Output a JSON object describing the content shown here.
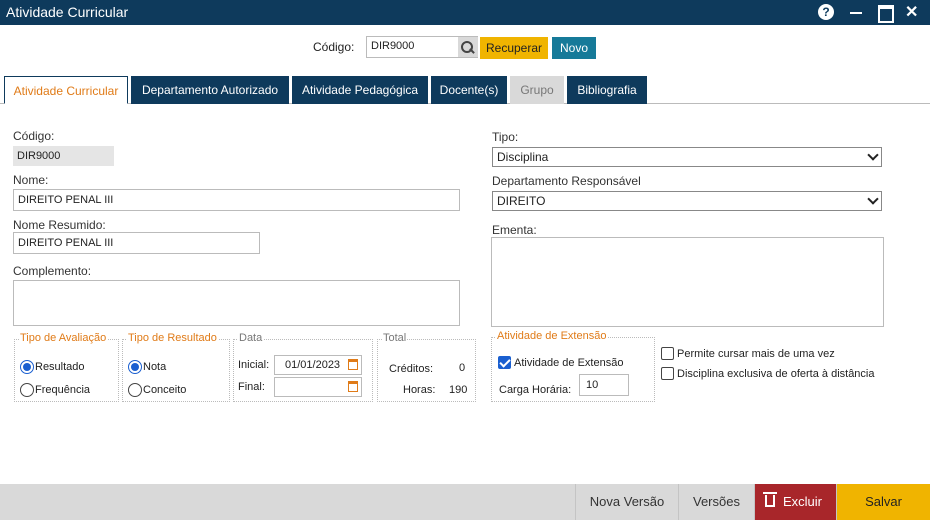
{
  "window": {
    "title": "Atividade Curricular"
  },
  "search": {
    "label": "Código:",
    "value": "DIR9000",
    "recuperar": "Recuperar",
    "novo": "Novo"
  },
  "tabs": [
    {
      "label": "Atividade Curricular",
      "state": "active"
    },
    {
      "label": "Departamento Autorizado",
      "state": "normal"
    },
    {
      "label": "Atividade Pedagógica",
      "state": "normal"
    },
    {
      "label": "Docente(s)",
      "state": "normal"
    },
    {
      "label": "Grupo",
      "state": "disabled"
    },
    {
      "label": "Bibliografia",
      "state": "normal"
    }
  ],
  "form": {
    "codigo_label": "Código:",
    "codigo_value": "DIR9000",
    "nome_label": "Nome:",
    "nome_value": "DIREITO PENAL III",
    "nome_resumido_label": "Nome Resumido:",
    "nome_resumido_value": "DIREITO PENAL III",
    "complemento_label": "Complemento:",
    "tipo_label": "Tipo:",
    "tipo_value": "Disciplina",
    "depto_label": "Departamento Responsável",
    "depto_value": "DIREITO",
    "ementa_label": "Ementa:"
  },
  "tipo_avaliacao": {
    "title": "Tipo de Avaliação",
    "options": [
      "Resultado",
      "Frequência"
    ],
    "selected": "Resultado"
  },
  "tipo_resultado": {
    "title": "Tipo de Resultado",
    "options": [
      "Nota",
      "Conceito"
    ],
    "selected": "Nota"
  },
  "data": {
    "title": "Data",
    "inicial_label": "Inicial:",
    "inicial_value": "01/01/2023",
    "final_label": "Final:",
    "final_value": ""
  },
  "total": {
    "title": "Total",
    "creditos_label": "Créditos:",
    "creditos_value": "0",
    "horas_label": "Horas:",
    "horas_value": "190"
  },
  "extensao": {
    "title": "Atividade de Extensão",
    "check_label": "Atividade de Extensão",
    "checked": true,
    "carga_label": "Carga Horária:",
    "carga_value": "10"
  },
  "options": [
    {
      "label": "Permite cursar mais de uma vez",
      "checked": false
    },
    {
      "label": "Disciplina exclusiva de oferta à distância",
      "checked": false
    }
  ],
  "footer": {
    "nova_versao": "Nova Versão",
    "versoes": "Versões",
    "excluir": "Excluir",
    "salvar": "Salvar"
  },
  "colors": {
    "header": "#0e3a5c",
    "accent": "#e07b18",
    "primary_button": "#f0b400",
    "new_button": "#167a99",
    "danger": "#a8262a"
  }
}
